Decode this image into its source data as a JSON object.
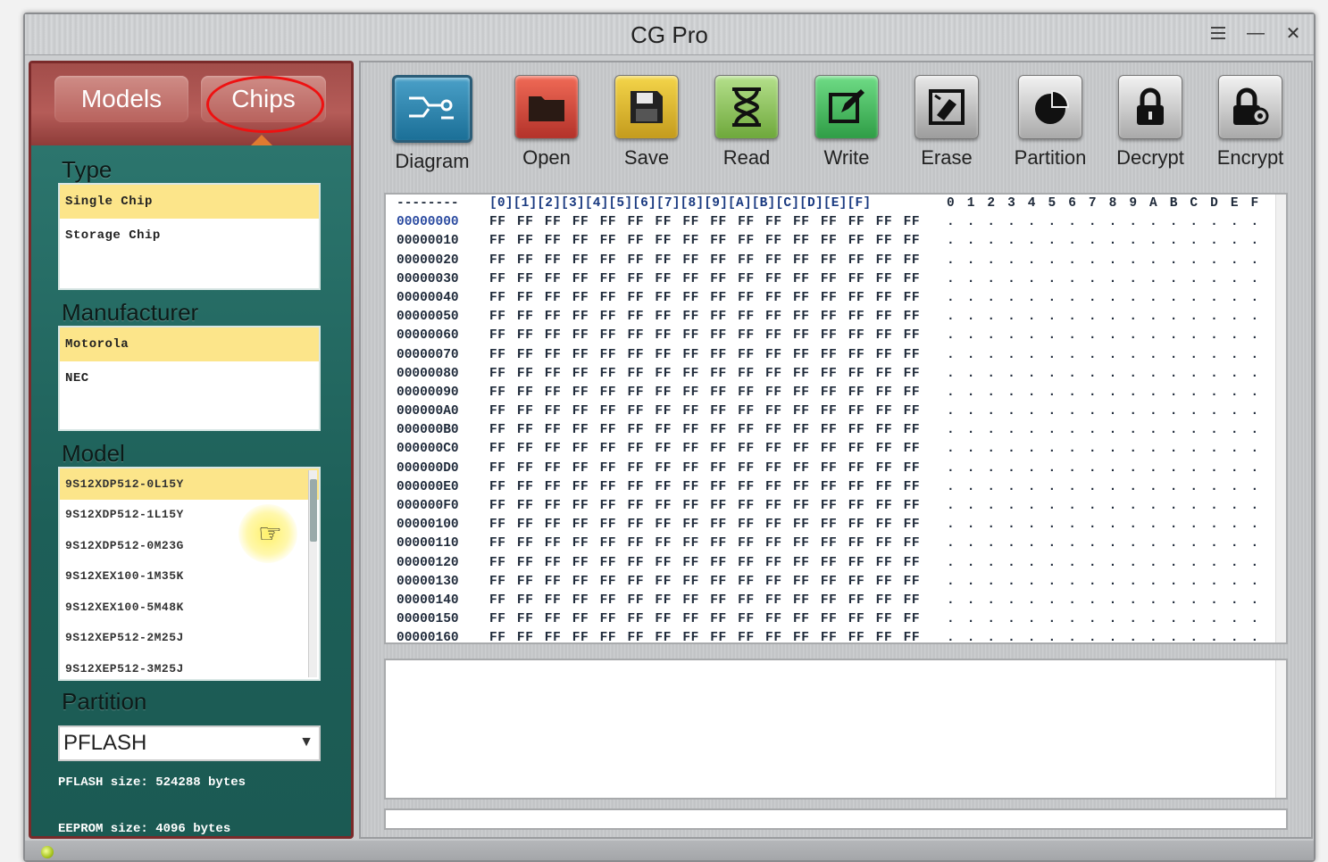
{
  "window": {
    "title": "CG Pro"
  },
  "sidebar": {
    "tabs": [
      {
        "label": "Models"
      },
      {
        "label": "Chips"
      }
    ],
    "type": {
      "label": "Type",
      "items": [
        {
          "label": "Single Chip",
          "selected": true
        },
        {
          "label": "Storage Chip",
          "selected": false
        }
      ]
    },
    "manufacturer": {
      "label": "Manufacturer",
      "items": [
        {
          "label": "Motorola",
          "selected": true
        },
        {
          "label": "NEC",
          "selected": false
        }
      ]
    },
    "model": {
      "label": "Model",
      "items": [
        {
          "label": "9S12XDP512-0L15Y",
          "selected": true
        },
        {
          "label": "9S12XDP512-1L15Y",
          "selected": false
        },
        {
          "label": "9S12XDP512-0M23G",
          "selected": false
        },
        {
          "label": "9S12XEX100-1M35K",
          "selected": false
        },
        {
          "label": "9S12XEX100-5M48K",
          "selected": false
        },
        {
          "label": "9S12XEP512-2M25J",
          "selected": false
        },
        {
          "label": "9S12XEP512-3M25J",
          "selected": false
        }
      ]
    },
    "partition": {
      "label": "Partition",
      "value": "PFLASH"
    },
    "info": [
      "PFLASH size: 524288 bytes",
      "EEPROM size: 4096 bytes"
    ]
  },
  "toolbar": [
    {
      "label": "Diagram",
      "icon": "diagram-icon"
    },
    {
      "label": "Open",
      "icon": "folder-icon"
    },
    {
      "label": "Save",
      "icon": "floppy-icon"
    },
    {
      "label": "Read",
      "icon": "hourglass-icon"
    },
    {
      "label": "Write",
      "icon": "pencil-icon"
    },
    {
      "label": "Erase",
      "icon": "eraser-icon"
    },
    {
      "label": "Partition",
      "icon": "pie-icon"
    },
    {
      "label": "Decrypt",
      "icon": "lock-icon"
    },
    {
      "label": "Encrypt",
      "icon": "lock-gear-icon"
    }
  ],
  "hex": {
    "header_addr": "--------",
    "header_bytes": "[0][1][2][3][4][5][6][7][8][9][A][B][C][D][E][F]",
    "header_ascii": "0123456789ABCDEF",
    "byte_row": "FF FF FF FF FF FF FF FF FF FF FF FF FF FF FF FF",
    "ascii_row": "................",
    "addresses": [
      "00000000",
      "00000010",
      "00000020",
      "00000030",
      "00000040",
      "00000050",
      "00000060",
      "00000070",
      "00000080",
      "00000090",
      "000000A0",
      "000000B0",
      "000000C0",
      "000000D0",
      "000000E0",
      "000000F0",
      "00000100",
      "00000110",
      "00000120",
      "00000130",
      "00000140",
      "00000150",
      "00000160"
    ]
  },
  "log": {
    "text": ""
  },
  "colors": {
    "accent_teal": "#1d5f58",
    "tab_red": "#b55c58",
    "selection_yellow": "#fce58a",
    "highlight_ring": "#ee1111"
  }
}
